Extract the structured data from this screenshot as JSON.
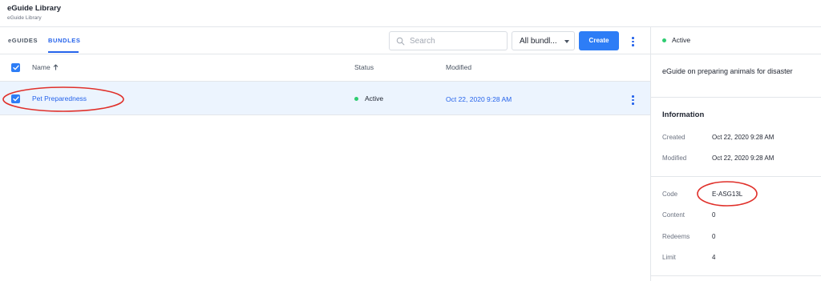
{
  "header": {
    "title": "eGuide Library",
    "subtitle": "eGuide Library"
  },
  "tabs": [
    {
      "label": "eGUIDES",
      "active": false
    },
    {
      "label": "BUNDLES",
      "active": true
    }
  ],
  "toolbar": {
    "search_placeholder": "Search",
    "filter_value": "All bundl...",
    "create_label": "Create"
  },
  "table": {
    "columns": {
      "name": "Name",
      "status": "Status",
      "modified": "Modified"
    },
    "sort": {
      "column": "Name",
      "direction": "ascending"
    },
    "all_selected": true,
    "rows": [
      {
        "name": "Pet Preparedness",
        "status": "Active",
        "modified": "Oct 22, 2020 9:28 AM",
        "selected": true
      }
    ]
  },
  "details": {
    "status": "Active",
    "description": "eGuide on preparing animals for disaster",
    "info_heading": "Information",
    "created_label": "Created",
    "created_value": "Oct 22, 2020 9:28 AM",
    "modified_label": "Modified",
    "modified_value": "Oct 22, 2020 9:28 AM",
    "code_label": "Code",
    "code_value": "E-ASG13L",
    "content_label": "Content",
    "content_value": "0",
    "redeems_label": "Redeems",
    "redeems_value": "0",
    "limit_label": "Limit",
    "limit_value": "4"
  },
  "colors": {
    "accent": "#2d7df6",
    "link": "#2563eb",
    "status_active": "#2ecc71",
    "row_selected_bg": "#ecf4fe",
    "annotation": "#e0302a"
  },
  "icons": [
    "search-icon",
    "chevron-down-icon",
    "more-vertical-icon",
    "sort-arrow-up-icon",
    "checkmark-icon",
    "status-dot-icon"
  ]
}
